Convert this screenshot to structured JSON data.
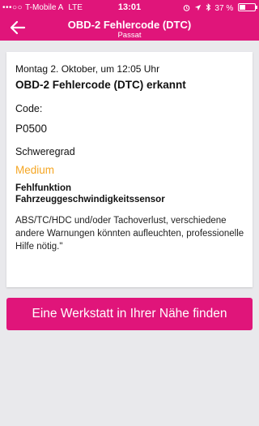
{
  "status_bar": {
    "signal_dots": "•••○○",
    "carrier": "T-Mobile A",
    "network": "LTE",
    "time": "13:01",
    "battery_percent": "37 %",
    "battery_level": 0.37
  },
  "header": {
    "title": "OBD-2 Fehlercode (DTC)",
    "subtitle": "Passat",
    "back_icon": "arrow-left-icon"
  },
  "card": {
    "date": "Montag 2. Oktober, um 12:05 Uhr",
    "heading": "OBD-2 Fehlercode (DTC) erkannt",
    "code_label": "Code:",
    "code_value": "P0500",
    "severity_label": "Schweregrad",
    "severity_value": "Medium",
    "severity_color": "#f5a623",
    "fault_line1": "Fehlfunktion",
    "fault_line2": "Fahrzeuggeschwindigkeitssensor",
    "description": "ABS/TC/HDC und/oder Tachoverlust, verschiedene andere Warnungen könnten aufleuchten, professionelle Hilfe nötig.\""
  },
  "cta": {
    "label": "Eine Werkstatt in Ihrer Nähe finden"
  },
  "colors": {
    "brand": "#e0157a",
    "background": "#e9e9ec"
  }
}
